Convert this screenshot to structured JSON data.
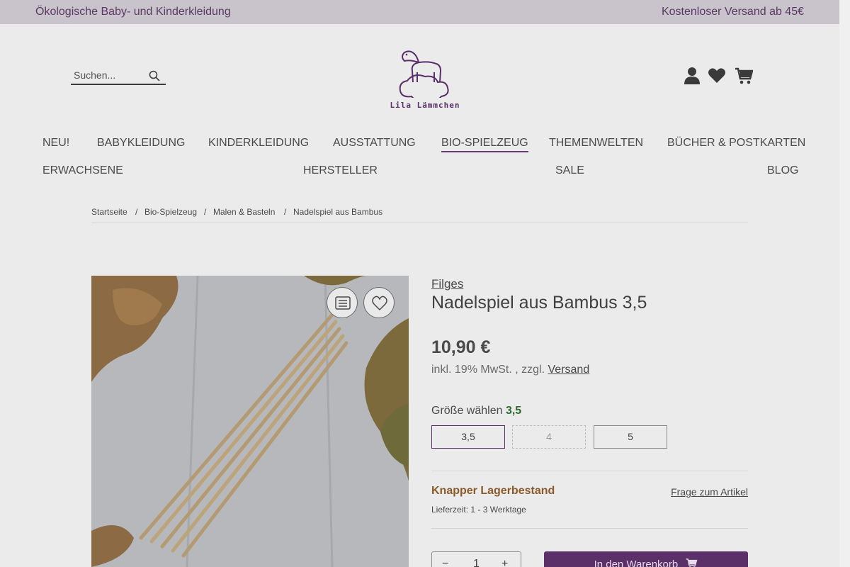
{
  "topbar": {
    "left_text": "Ökologische Baby- und Kinderkleidung",
    "right_text": "Kostenloser Versand ab 45€"
  },
  "search": {
    "placeholder": "Suchen...",
    "icon": "search-icon"
  },
  "logo": {
    "name": "Lila Lämmchen"
  },
  "header_icons": [
    "user-icon",
    "heart-icon",
    "cart-icon"
  ],
  "nav": {
    "row1": [
      "NEU!",
      "BABYKLEIDUNG",
      "KINDERKLEIDUNG",
      "AUSSTATTUNG",
      "BIO-SPIELZEUG",
      "THEMENWELTEN",
      "BÜCHER & POSTKARTEN"
    ],
    "row2": [
      "ERWACHSENE",
      "HERSTELLER",
      "SALE",
      "BLOG"
    ],
    "active": "BIO-SPIELZEUG"
  },
  "breadcrumb": [
    "Startseite",
    "/",
    "Bio-Spielzeug",
    "/",
    "Malen & Basteln",
    "/",
    "Nadelspiel aus Bambus"
  ],
  "product": {
    "manufacturer": "Filges",
    "title": "Nadelspiel aus Bambus 3,5",
    "price": "10,90 €",
    "tax_prefix": "inkl. 19% MwSt. , zzgl.",
    "tax_link": "Versand",
    "size_label": "Größe wählen",
    "size_selected": "3,5",
    "sizes": [
      "3,5",
      "4",
      "5"
    ],
    "stock": "Knapper Lagerbestand",
    "delivery": "Lieferzeit: 1 - 3 Werktage",
    "question": "Frage zum Artikel",
    "qty": "1",
    "add_to_cart": "In den Warenkorb"
  },
  "colors": {
    "brand": "#5b2f68",
    "overlay": "#ebebeb",
    "stock": "#8a5a2a",
    "size_selected": "#2e6b2e"
  }
}
